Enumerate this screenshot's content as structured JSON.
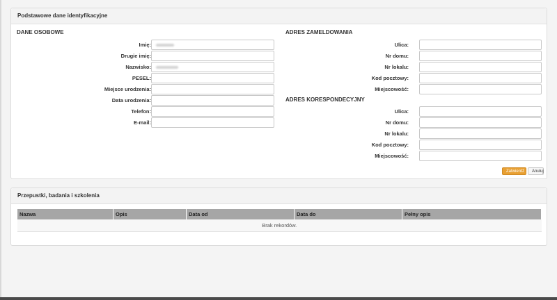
{
  "panel_identity": {
    "title": "Podstawowe dane identyfikacyjne",
    "personal": {
      "heading": "DANE OSOBOWE",
      "fields": [
        {
          "label": "Imię:",
          "value": "",
          "blurred": true
        },
        {
          "label": "Drugie imię:",
          "value": ""
        },
        {
          "label": "Nazwisko:",
          "value": "",
          "blurred": true
        },
        {
          "label": "PESEL:",
          "value": ""
        },
        {
          "label": "Miejsce urodzenia:",
          "value": ""
        },
        {
          "label": "Data urodzenia:",
          "value": ""
        },
        {
          "label": "Telefon:",
          "value": ""
        },
        {
          "label": "E-mail:",
          "value": ""
        }
      ]
    },
    "registered_address": {
      "heading": "ADRES ZAMELDOWANIA",
      "fields": [
        {
          "label": "Ulica:"
        },
        {
          "label": "Nr domu:"
        },
        {
          "label": "Nr lokalu:"
        },
        {
          "label": "Kod pocztowy:"
        },
        {
          "label": "Miejscowość:"
        }
      ]
    },
    "correspondence_address": {
      "heading": "ADRES KORESPONDECYJNY",
      "fields": [
        {
          "label": "Ulica:"
        },
        {
          "label": "Nr domu:"
        },
        {
          "label": "Nr lokalu:"
        },
        {
          "label": "Kod pocztowy:"
        },
        {
          "label": "Miejscowość:"
        }
      ]
    },
    "buttons": {
      "save": "Zatwierdź",
      "cancel": "Anuluj"
    }
  },
  "panel_passes": {
    "title": "Przepustki, badania i szkolenia",
    "columns": [
      "Nazwa",
      "Opis",
      "Data od",
      "Data do",
      "Pełny opis"
    ],
    "empty_message": "Brak rekordów."
  },
  "colors": {
    "accent": "#e8a033",
    "table_header": "#a6a6a6"
  }
}
